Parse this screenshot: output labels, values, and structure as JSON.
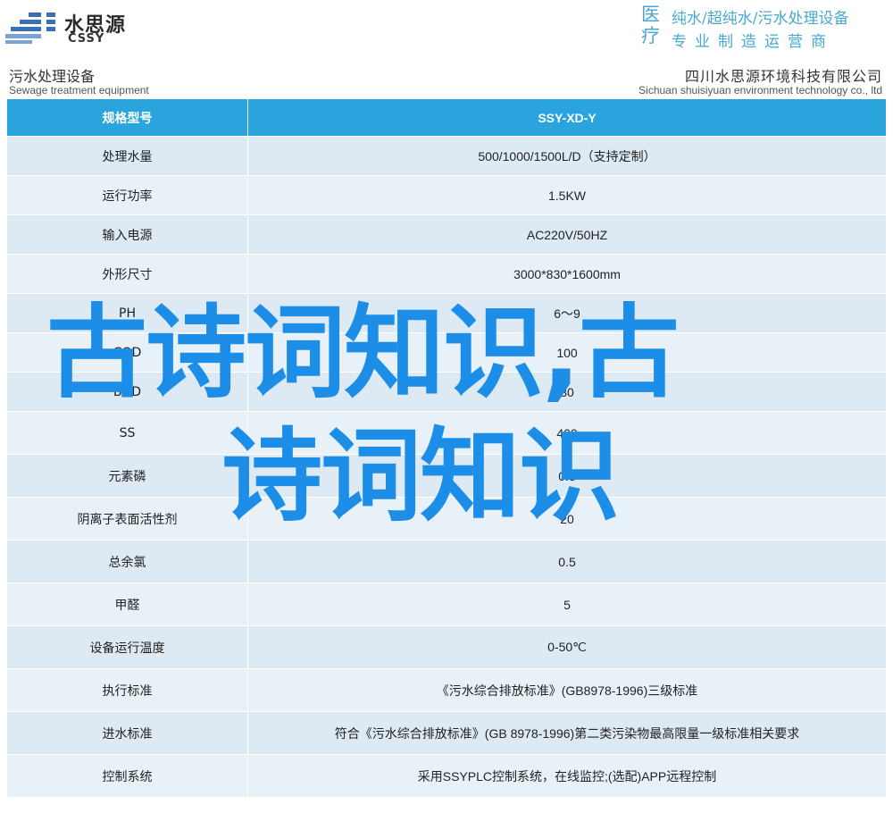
{
  "header": {
    "logo_cn": "水思源",
    "logo_en": "CSSY",
    "tag_big": "医疗",
    "tag_line1": "纯水/超纯水/污水处理设备",
    "tag_line2": "专业制造运营商"
  },
  "title": {
    "left_cn": "污水处理设备",
    "left_en": "Sewage treatment equipment",
    "right_cn": "四川水思源环境科技有限公司",
    "right_en": "Sichuan shuisiyuan environment technology co., ltd"
  },
  "table": {
    "header": {
      "label": "规格型号",
      "value": "SSY-XD-Y"
    },
    "rows": [
      {
        "label": "处理水量",
        "value": "500/1000/1500L/D（支持定制）"
      },
      {
        "label": "运行功率",
        "value": "1.5KW"
      },
      {
        "label": "输入电源",
        "value": "AC220V/50HZ"
      },
      {
        "label": "外形尺寸",
        "value": "3000*830*1600mm"
      },
      {
        "label": "PH",
        "value": "6～9"
      },
      {
        "label": "COD",
        "value": "100"
      },
      {
        "label": "BOD",
        "value": "30"
      },
      {
        "label": "SS",
        "value": "400"
      },
      {
        "label": "元素磷",
        "value": "0.3"
      },
      {
        "label": "阴离子表面活性剂",
        "value": "20"
      },
      {
        "label": "总余氯",
        "value": "0.5"
      },
      {
        "label": "甲醛",
        "value": "5"
      },
      {
        "label": "设备运行温度",
        "value": "0-50℃"
      },
      {
        "label": "执行标准",
        "value": "《污水综合排放标准》(GB8978-1996)三级标准"
      },
      {
        "label": "进水标准",
        "value": "符合《污水综合排放标准》(GB 8978-1996)第二类污染物最高限量一级标准相关要求"
      },
      {
        "label": "控制系统",
        "value": "采用SSYPLC控制系统，在线监控;(选配)APP远程控制"
      }
    ]
  },
  "overlay": {
    "line1": "古诗词知识,古",
    "line2": "诗词知识"
  },
  "colors": {
    "accent": "#29a4dd",
    "row_a": "#dde9f3",
    "row_b": "#e9f1f8",
    "overlay_text": "#1d8ee8",
    "tagline": "#4aa8cf"
  }
}
